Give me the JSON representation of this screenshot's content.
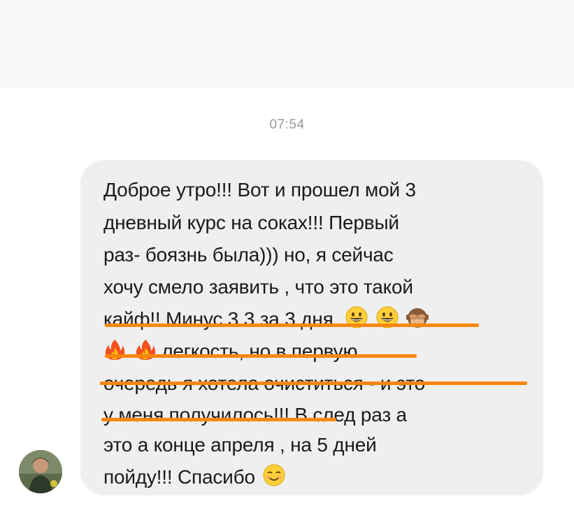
{
  "chat": {
    "timestamp": "07:54",
    "message": {
      "line1": "Доброе утро!!! Вот и прошел мой 3",
      "line2": "дневный курс на соках!!! Первый",
      "line3": "раз- боязнь была))) но, я сейчас",
      "line4": "хочу смело заявить , что это такой",
      "line5": "кайф!! Минус 3.3 за 3 дня",
      "line6": "легкость, но в первую",
      "line7": "очередь я хотела очиститься - и это",
      "line8": "у меня получилось!!! В след раз а",
      "line9": "это а конце апреля , на 5 дней",
      "line10": "пойду!!! Спасибо"
    },
    "emojis": [
      "grinning-face",
      "grinning-face",
      "see-no-evil-monkey",
      "fire",
      "fire",
      "smiling-face"
    ],
    "highlight_color": "#f7870f",
    "bubble_color": "#efefef"
  }
}
